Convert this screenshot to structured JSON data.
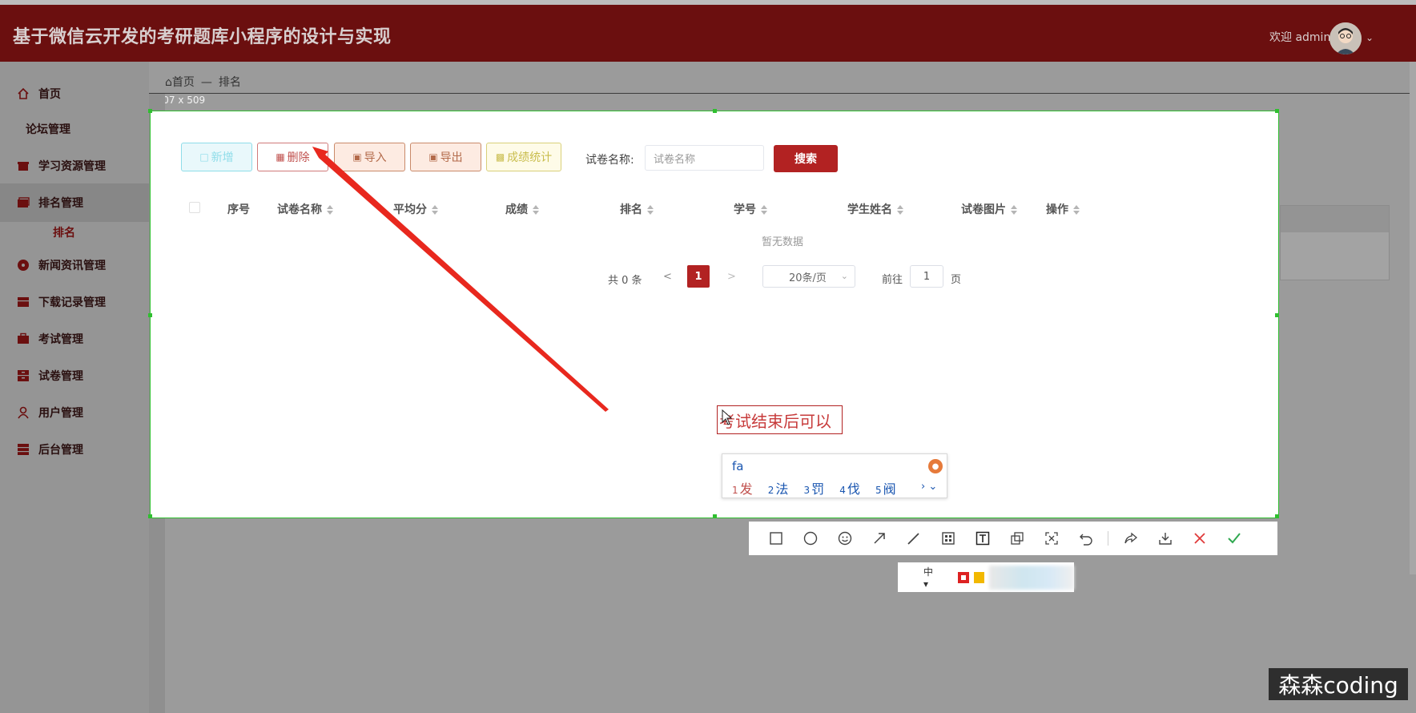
{
  "header": {
    "title": "基于微信云开发的考研题库小程序的设计与实现",
    "welcome": "欢迎 admin"
  },
  "sidebar": {
    "items": [
      {
        "label": "首页",
        "icon": "home-icon"
      },
      {
        "label": "论坛管理",
        "icon": ""
      },
      {
        "label": "学习资源管理",
        "icon": "gift-icon"
      },
      {
        "label": "排名管理",
        "icon": "folder-icon"
      },
      {
        "label": "新闻资讯管理",
        "icon": "dot-icon"
      },
      {
        "label": "下载记录管理",
        "icon": "archive-icon"
      },
      {
        "label": "考试管理",
        "icon": "briefcase-icon"
      },
      {
        "label": "试卷管理",
        "icon": "archive-icon"
      },
      {
        "label": "用户管理",
        "icon": "user-icon"
      },
      {
        "label": "后台管理",
        "icon": "archive-icon"
      }
    ],
    "active_sub": "排名"
  },
  "breadcrumb": {
    "home": "首页",
    "sep": "—",
    "current": "排名"
  },
  "selection_size": "1407 x 509",
  "toolbar": {
    "add": "新增",
    "delete": "删除",
    "import": "导入",
    "export": "导出",
    "stats": "成绩统计",
    "search_label": "试卷名称:",
    "search_placeholder": "试卷名称",
    "search_button": "搜索"
  },
  "table": {
    "columns": [
      "序号",
      "试卷名称",
      "平均分",
      "成绩",
      "排名",
      "学号",
      "学生姓名",
      "试卷图片",
      "操作"
    ],
    "empty_text": "暂无数据"
  },
  "pagination": {
    "total": "共 0 条",
    "prev": "<",
    "current": "1",
    "next": ">",
    "page_size": "20条/页",
    "goto": "前往",
    "goto_value": "1",
    "page_unit": "页"
  },
  "annotation": {
    "text": "考试结束后可以",
    "arrow_color": "#e8281e"
  },
  "ime": {
    "code": "fa",
    "candidates": [
      {
        "n": "1",
        "w": "发"
      },
      {
        "n": "2",
        "w": "法"
      },
      {
        "n": "3",
        "w": "罚"
      },
      {
        "n": "4",
        "w": "伐"
      },
      {
        "n": "5",
        "w": "阀"
      }
    ]
  },
  "snip_tool": {
    "size_label": "中",
    "colors": [
      "#d22222",
      "#f2b800"
    ]
  },
  "watermark": "森森coding",
  "colors": {
    "brand": "#6b0f0f",
    "primary_button": "#b22222",
    "selection_border": "#2fbf2f"
  }
}
